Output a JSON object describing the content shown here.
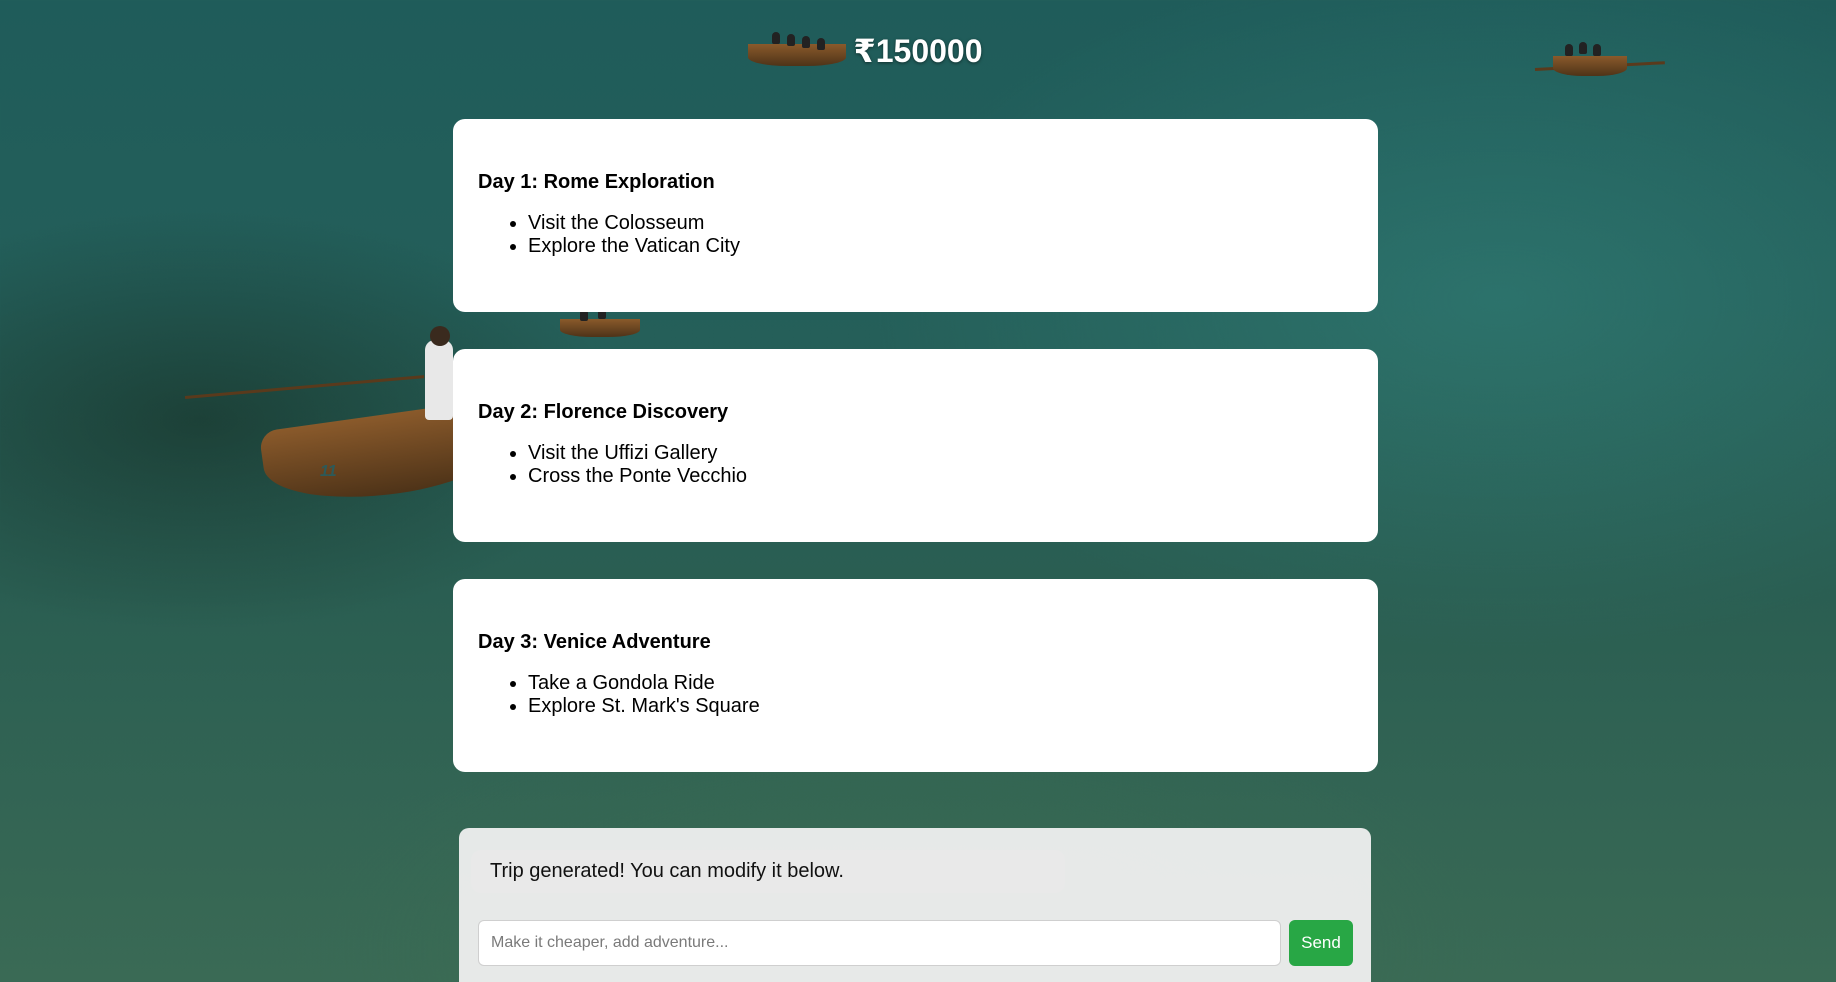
{
  "header": {
    "budget": "₹150000"
  },
  "itinerary": [
    {
      "title": "Day 1: Rome Exploration",
      "activities": [
        "Visit the Colosseum",
        "Explore the Vatican City"
      ]
    },
    {
      "title": "Day 2: Florence Discovery",
      "activities": [
        "Visit the Uffizi Gallery",
        "Cross the Ponte Vecchio"
      ]
    },
    {
      "title": "Day 3: Venice Adventure",
      "activities": [
        "Take a Gondola Ride",
        "Explore St. Mark's Square"
      ]
    }
  ],
  "chat": {
    "message": "Trip generated! You can modify it below.",
    "input_value": "",
    "input_placeholder": "Make it cheaper, add adventure...",
    "send_label": "Send"
  },
  "background": {
    "boat_number": "11"
  },
  "colors": {
    "send_button": "#28a745",
    "card_background": "#ffffff",
    "water": "#245f5a"
  }
}
